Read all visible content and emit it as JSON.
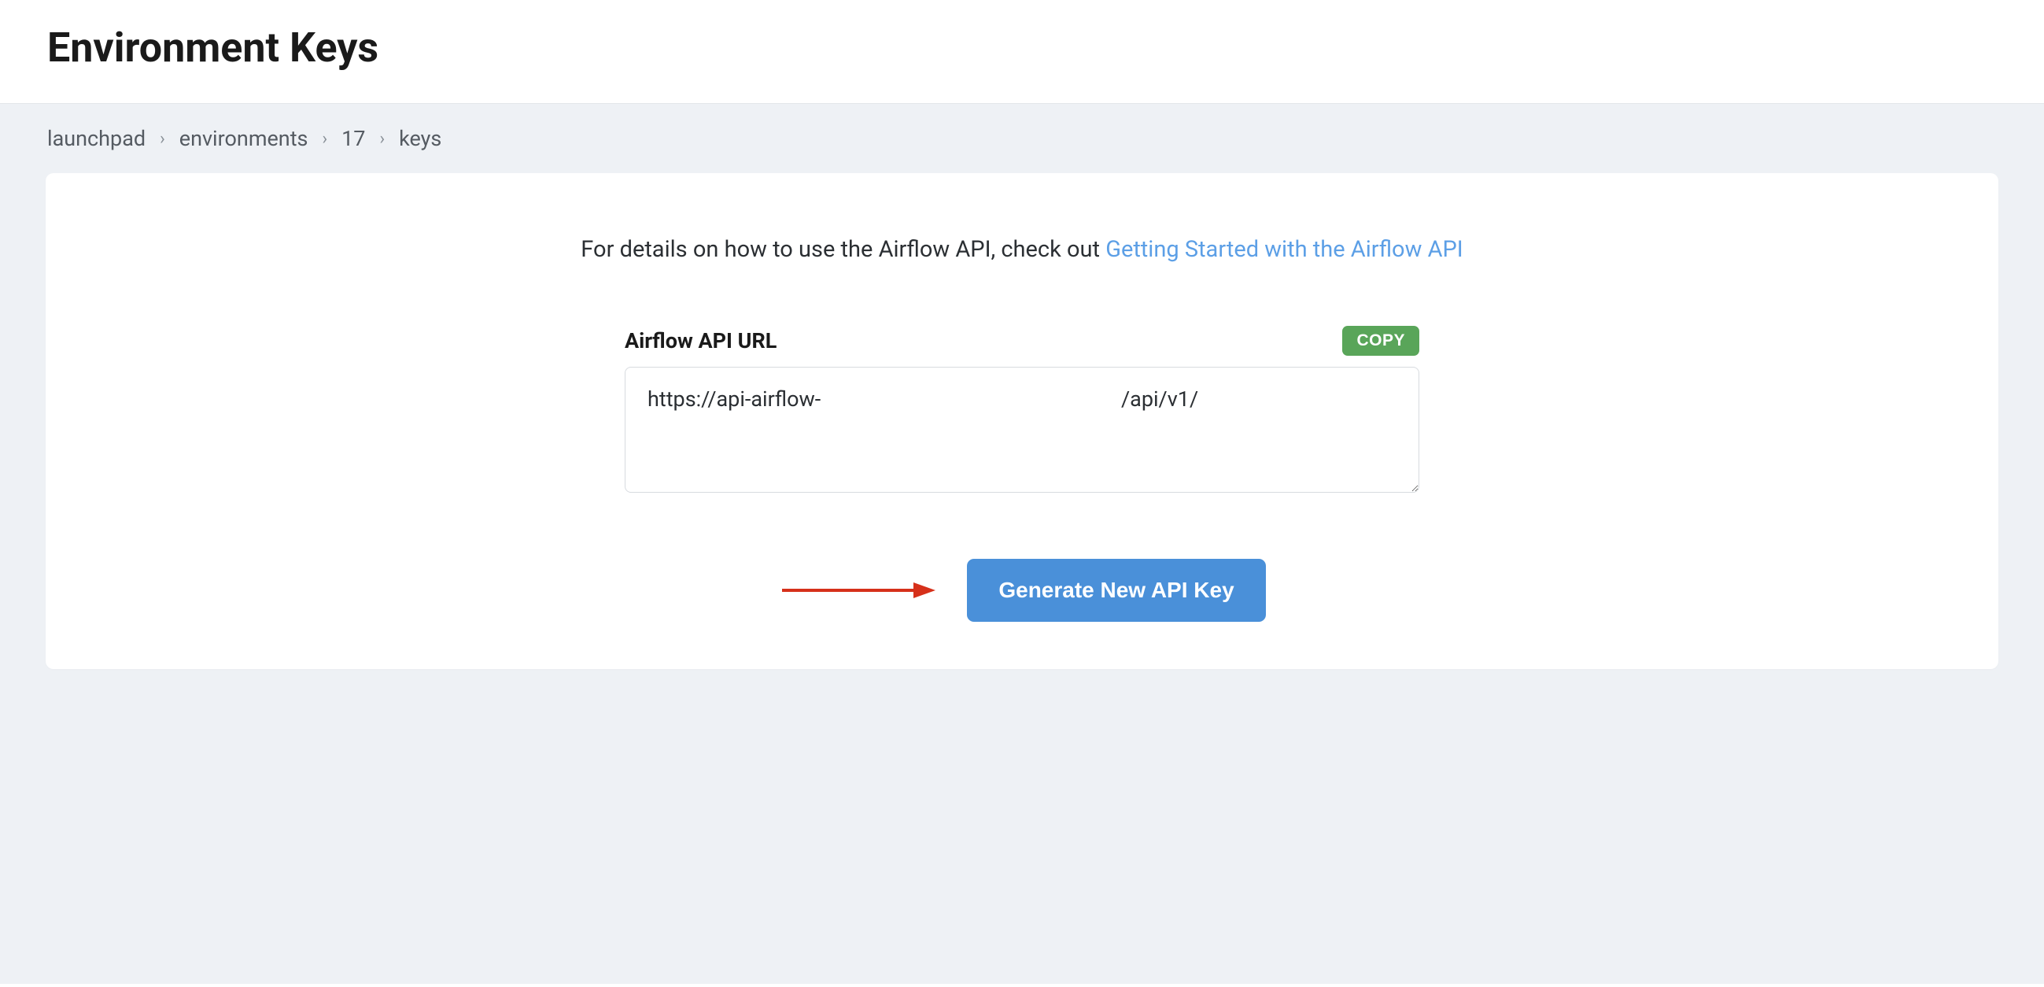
{
  "header": {
    "title": "Environment Keys"
  },
  "breadcrumb": {
    "items": [
      "launchpad",
      "environments",
      "17",
      "keys"
    ]
  },
  "card": {
    "intro_prefix": "For details on how to use the Airflow API, check out ",
    "intro_link": "Getting Started with the Airflow API",
    "api_label": "Airflow API URL",
    "copy_label": "COPY",
    "api_url_value": "https://api-airflow-                                                         /api/v1/",
    "generate_label": "Generate New API Key"
  }
}
